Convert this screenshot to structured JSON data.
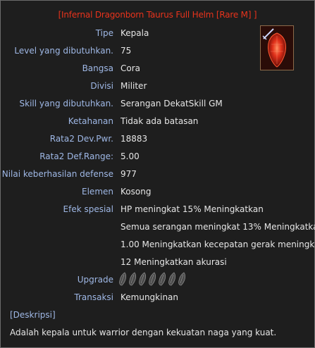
{
  "title": "[Infernal Dragonborn Taurus Full Helm [Rare M] ]",
  "rows": [
    {
      "label": "Tipe",
      "value": "Kepala"
    },
    {
      "label": "Level yang dibutuhkan.",
      "value": "75"
    },
    {
      "label": "Bangsa",
      "value": "Cora"
    },
    {
      "label": "Divisi",
      "value": "Militer"
    },
    {
      "label": "Skill yang dibutuhkan.",
      "value": "Serangan DekatSkill GM"
    },
    {
      "label": "Ketahanan",
      "value": "Tidak ada batasan"
    },
    {
      "label": "Rata2 Dev.Pwr.",
      "value": "18883"
    },
    {
      "label": "Rata2 Def.Range:",
      "value": "5.00"
    },
    {
      "label": "Nilai keberhasilan defense",
      "value": "977"
    },
    {
      "label": "Elemen",
      "value": "Kosong"
    },
    {
      "label": "Efek spesial",
      "value": "HP meningkat 15% Meningkatkan"
    }
  ],
  "special_effects_continued": [
    "Semua serangan meningkat 13% Meningkatkan",
    "1.00 Meningkatkan kecepatan gerak meningkat.",
    "12 Meningkatkan akurasi"
  ],
  "upgrade": {
    "label": "Upgrade",
    "slots": 7,
    "slot_icon": "empty-talic-slot-icon"
  },
  "transaction": {
    "label": "Transaksi",
    "value": "Kemungkinan"
  },
  "description_header": "[Deskripsi]",
  "description": "Adalah kepala untuk warrior dengan kekuatan naga yang kuat.",
  "item_icon": "red-helm-item-icon",
  "colors": {
    "title": "#e8331c",
    "label": "#9fb8e6",
    "value": "#e6e6e6",
    "background": "#1e1e1e"
  }
}
